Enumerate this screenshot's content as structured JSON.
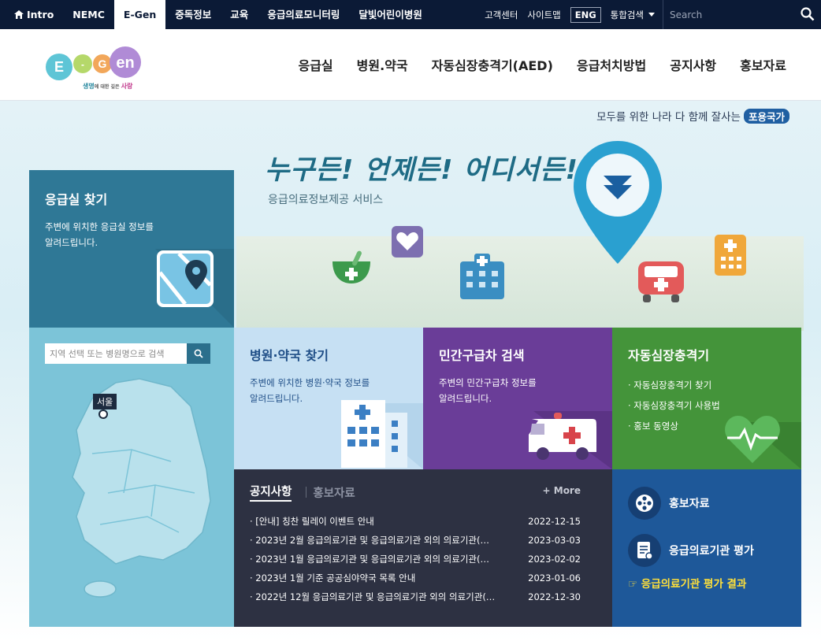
{
  "topnav": {
    "items": [
      {
        "label": "Intro",
        "active": false
      },
      {
        "label": "NEMC",
        "active": false
      },
      {
        "label": "E-Gen",
        "active": true
      },
      {
        "label": "중독정보",
        "active": false
      },
      {
        "label": "교육",
        "active": false
      },
      {
        "label": "응급의료모니터링",
        "active": false
      },
      {
        "label": "달빛어린이병원",
        "active": false
      }
    ],
    "util": {
      "customer": "고객센터",
      "sitemap": "사이트맵",
      "eng": "ENG",
      "search_type": "통합검색",
      "search_placeholder": "Search"
    }
  },
  "logo": {
    "text": "E-Gen",
    "tagline_a": "생명",
    "tagline_b": "에 대한 깊은 ",
    "tagline_c": "사랑"
  },
  "mainnav": [
    "응급실",
    "병원.약국",
    "자동심장충격기(AED)",
    "응급처치방법",
    "공지사항",
    "홍보자료"
  ],
  "hero": {
    "slogan": "모두를 위한 나라 다 함께 잘사는",
    "slogan_tag": "포용국가",
    "title": "누구든! 언제든! 어디서든!",
    "subtitle": "응급의료정보제공 서비스"
  },
  "tiles": {
    "er": {
      "title": "응급실 찾기",
      "desc1": "주변에 위치한 응급실 정보를",
      "desc2": "알려드립니다."
    },
    "map": {
      "search_placeholder": "지역 선택 또는 병원명으로 검색",
      "region_label": "서울"
    },
    "hospital": {
      "title": "병원·약국 찾기",
      "desc1": "주변에 위치한 병원·약국 정보를",
      "desc2": "알려드립니다."
    },
    "ambulance": {
      "title": "민간구급차 검색",
      "desc1": "주변의 민간구급차 정보를",
      "desc2": "알려드립니다."
    },
    "aed": {
      "title": "자동심장충격기",
      "links": [
        "· 자동심장충격기 찾기",
        "· 자동심장충격기 사용법",
        "· 홍보 동영상"
      ]
    },
    "notice": {
      "tab_notice": "공지사항",
      "tab_pr": "홍보자료",
      "more": "+ More",
      "rows": [
        {
          "title": "· [안내] 칭찬 릴레이 이벤트 안내",
          "date": "2022-12-15"
        },
        {
          "title": "· 2023년 2월 응급의료기관 및 응급의료기관 외의 의료기관(…",
          "date": "2023-03-03"
        },
        {
          "title": "· 2023년 1월 응급의료기관 및 응급의료기관 외의 의료기관(…",
          "date": "2023-02-02"
        },
        {
          "title": "· 2023년 1월 기준 공공심야약국 목록 안내",
          "date": "2023-01-06"
        },
        {
          "title": "· 2022년 12월 응급의료기관 및 응급의료기관 외의 의료기관(…",
          "date": "2022-12-30"
        }
      ]
    },
    "pr": {
      "item1": "홍보자료",
      "item2": "응급의료기관 평가",
      "result": "☞ 응급의료기관 평가 결과"
    }
  },
  "colors": {
    "topbar": "#0b1a36",
    "er": "#2f7896",
    "map": "#7cc4d8",
    "hospital": "#c6e0f3",
    "ambulance": "#6a3d98",
    "aed": "#44943a",
    "notice": "#2d3142",
    "pr": "#1e5899",
    "highlight": "#ffe03a"
  }
}
